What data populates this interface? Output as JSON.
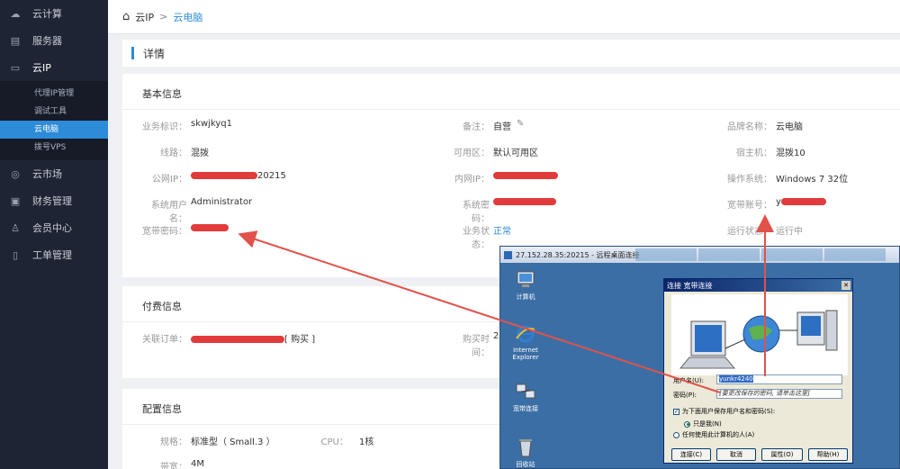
{
  "sidebar": {
    "items": [
      {
        "label": "云计算",
        "icon": "cloud-icon"
      },
      {
        "label": "服务器",
        "icon": "server-icon"
      },
      {
        "label": "云IP",
        "icon": "monitor-icon"
      },
      {
        "label": "云市场",
        "icon": "market-icon"
      },
      {
        "label": "财务管理",
        "icon": "finance-icon"
      },
      {
        "label": "会员中心",
        "icon": "user-icon"
      },
      {
        "label": "工单管理",
        "icon": "ticket-icon"
      }
    ],
    "sub_items": [
      "代理IP管理",
      "调试工具",
      "云电脑",
      "拨号VPS"
    ]
  },
  "breadcrumb": {
    "root": "云IP",
    "sep": ">",
    "current": "云电脑"
  },
  "detail_title": "详情",
  "basic": {
    "title": "基本信息",
    "business_id_label": "业务标识：",
    "business_id": "skwjkyq1",
    "remark_label": "备注：",
    "remark": "自营",
    "brand_label": "品牌名称：",
    "brand": "云电脑",
    "line_label": "线路：",
    "line": "混拨",
    "zone_label": "可用区：",
    "zone": "默认可用区",
    "host_label": "宿主机：",
    "host": "混拨10",
    "public_ip_label": "公网IP：",
    "public_ip_tail": "20215",
    "private_ip_label": "内网IP：",
    "os_label": "操作系统：",
    "os": "Windows 7 32位",
    "sys_user_label": "系统用户名：",
    "sys_user": "Administrator",
    "sys_pwd_label": "系统密码：",
    "bb_account_label": "宽带账号：",
    "bb_account_head": "y",
    "bb_pwd_label": "宽带密码：",
    "biz_status_label": "业务状态：",
    "biz_status": "正常",
    "run_status_label": "运行状态：",
    "run_status": "运行中"
  },
  "billing": {
    "title": "付费信息",
    "order_label": "关联订单：",
    "order_action": "[ 购买 ]",
    "buy_time_label": "购买时间：",
    "buy_time_head": "20"
  },
  "config": {
    "title": "配置信息",
    "spec_label": "规格：",
    "spec": "标准型（ Small.3 ）",
    "cpu_label": "CPU：",
    "cpu": "1核",
    "bandwidth_label": "带宽：",
    "bandwidth": "4M"
  },
  "rdp": {
    "title": "27.152.28.35:20215 - 远程桌面连接",
    "icons": [
      "计算机",
      "Internet Explorer",
      "宽带连接",
      "回收站"
    ]
  },
  "dialog": {
    "title": "连接 宽带连接",
    "username_label": "用户名(U):",
    "username": "yunkr4240",
    "password_label": "密码(P):",
    "password_hint": "[要更改保存的密码, 请单击这里]",
    "save_label": "为下面用户保存用户名和密码(S):",
    "only_me": "只是我(N)",
    "anyone": "任何使用此计算机的人(A)",
    "btn_connect": "连接(C)",
    "btn_cancel": "取消",
    "btn_props": "属性(O)",
    "btn_help": "帮助(H)"
  },
  "colors": {
    "accent": "#2d8bd8",
    "sidebar": "#1e2433",
    "redact": "#e23b3b",
    "arrow": "#e0524a"
  }
}
